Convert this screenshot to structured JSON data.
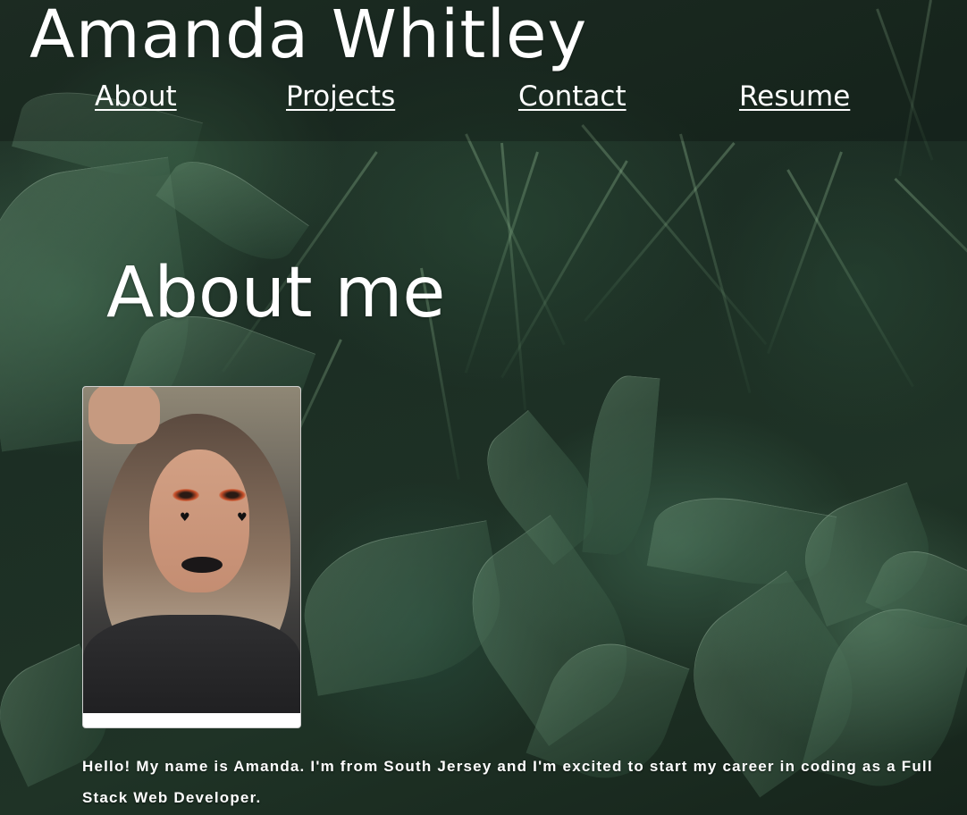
{
  "site": {
    "title": "Amanda Whitley"
  },
  "nav": {
    "items": [
      {
        "label": "About"
      },
      {
        "label": "Projects"
      },
      {
        "label": "Contact"
      },
      {
        "label": "Resume"
      }
    ]
  },
  "about": {
    "heading": "About me",
    "photo_alt": "Photo of Amanda",
    "bio": "Hello! My name is Amanda. I'm from South Jersey and I'm excited to start my career in coding as a Full Stack Web Developer."
  },
  "colors": {
    "text": "#ffffff",
    "header_overlay": "rgba(0,0,0,0.22)",
    "background": "#1b2a22"
  }
}
